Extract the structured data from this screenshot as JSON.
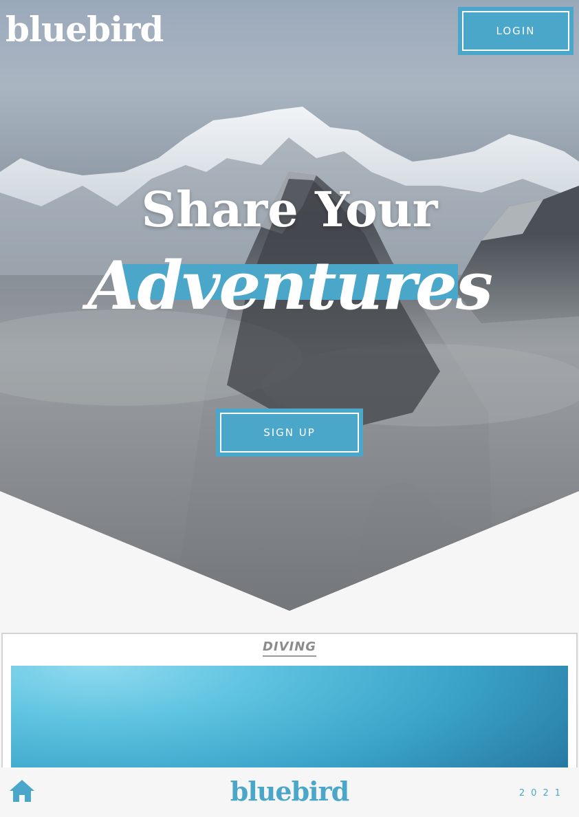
{
  "header": {
    "logo": "bluebird",
    "login_label": "LOGIN"
  },
  "hero": {
    "headline_line1": "Share Your",
    "headline_line2": "Adventures",
    "signup_label": "SIGN UP"
  },
  "card": {
    "title": "DIVING"
  },
  "footer": {
    "logo": "bluebird",
    "year": "2021"
  },
  "icons": {
    "home": "home-icon"
  },
  "colors": {
    "accent": "#4ba7c9",
    "background": "#f6f6f6",
    "text_light": "#ffffff",
    "card_title": "#8c8c8c"
  }
}
